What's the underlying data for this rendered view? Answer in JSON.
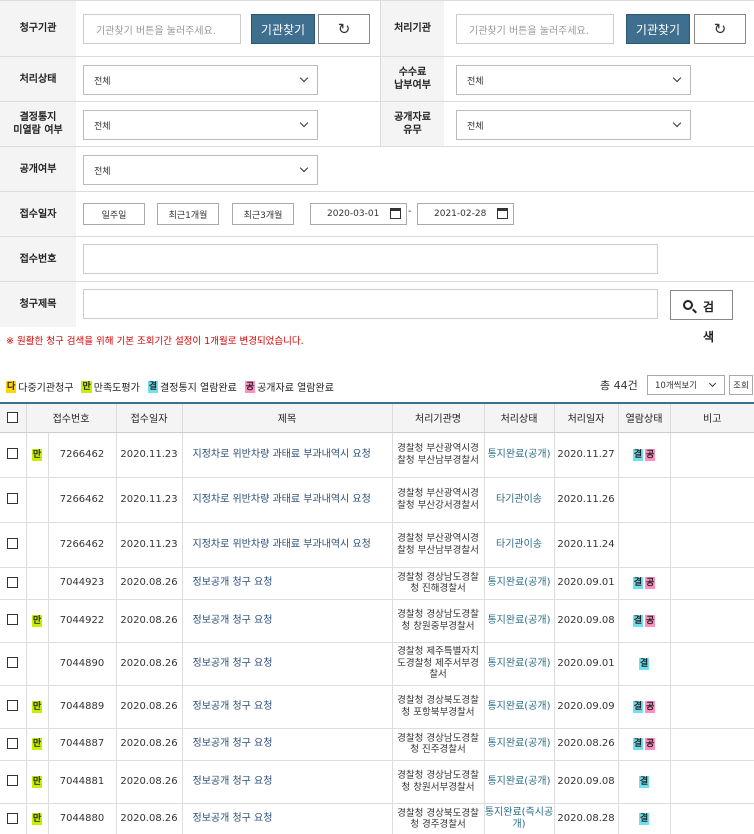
{
  "form": {
    "claim_org_label": "청구기관",
    "org_placeholder": "기관찾기 버튼을 눌러주세요.",
    "find_btn": "기관찾기",
    "proc_org_label": "처리기관",
    "proc_status_label": "처리상태",
    "fee_label_1": "수수료",
    "fee_label_2": "납부여부",
    "notice_label_1": "결정통지",
    "notice_label_2": "미열람 여부",
    "data_label_1": "공개자료",
    "data_label_2": "유무",
    "open_label": "공개여부",
    "all_option": "전체",
    "date_label": "접수일자",
    "period_1w": "일주일",
    "period_1m": "최근1개월",
    "period_3m": "최근3개월",
    "date_from": "2020-03-01",
    "date_to": "2021-02-28",
    "date_sep": "-",
    "recv_no_label": "접수번호",
    "title_label": "청구제목",
    "search_btn_1": "검",
    "search_btn_2": "색",
    "notice_msg": "※ 원활한 청구 검색을 위해 기본 조회기간 설정이 1개월로 변경되었습니다."
  },
  "legend": [
    {
      "badge": "다",
      "text": "다중기관청구",
      "color": "#ffd600"
    },
    {
      "badge": "만",
      "text": "만족도평가",
      "color": "#c6f000"
    },
    {
      "badge": "결",
      "text": "결정통지 열람완료",
      "color": "#6ee0f0"
    },
    {
      "badge": "공",
      "text": "공개자료 열람완료",
      "color": "#ff8fc0"
    }
  ],
  "total_text": "총 44건",
  "per_page": "10개씩보기",
  "view_btn": "조회",
  "columns": [
    "접수번호",
    "접수일자",
    "제목",
    "처리기관명",
    "처리상태",
    "처리일자",
    "열람상태",
    "비고"
  ],
  "rows": [
    {
      "man": "만",
      "no": "7266462",
      "date": "2020.11.23",
      "title": "지정차로 위반차량 과태료 부과내역시 요청",
      "org": "경찰청 부산광역시경찰청 부산남부경찰서",
      "status": "통지완료(공개)",
      "proc_date": "2020.11.27",
      "gyeol": "결",
      "gong": "공"
    },
    {
      "man": "",
      "no": "7266462",
      "date": "2020.11.23",
      "title": "지정차로 위반차량 과태료 부과내역시 요청",
      "org": "경찰청 부산광역시경찰청 부산강서경찰서",
      "status": "타기관이송",
      "proc_date": "2020.11.26",
      "gyeol": "",
      "gong": ""
    },
    {
      "man": "",
      "no": "7266462",
      "date": "2020.11.23",
      "title": "지정차로 위반차량 과태료 부과내역시 요청",
      "org": "경찰청 부산광역시경찰청 부산남부경찰서",
      "status": "타기관이송",
      "proc_date": "2020.11.24",
      "gyeol": "",
      "gong": ""
    },
    {
      "man": "",
      "no": "7044923",
      "date": "2020.08.26",
      "title": "정보공개 청구 요청",
      "org": "경찰청 경상남도경찰청 진해경찰서",
      "status": "통지완료(공개)",
      "proc_date": "2020.09.01",
      "gyeol": "결",
      "gong": "공"
    },
    {
      "man": "만",
      "no": "7044922",
      "date": "2020.08.26",
      "title": "정보공개 청구 요청",
      "org": "경찰청 경상남도경찰청 창원중부경찰서",
      "status": "통지완료(공개)",
      "proc_date": "2020.09.08",
      "gyeol": "결",
      "gong": "공"
    },
    {
      "man": "",
      "no": "7044890",
      "date": "2020.08.26",
      "title": "정보공개 청구 요청",
      "org": "경찰청 제주특별자치도경찰청 제주서부경찰서",
      "status": "통지완료(공개)",
      "proc_date": "2020.09.01",
      "gyeol": "결",
      "gong": ""
    },
    {
      "man": "만",
      "no": "7044889",
      "date": "2020.08.26",
      "title": "정보공개 청구 요청",
      "org": "경찰청 경상북도경찰청 포항북부경찰서",
      "status": "통지완료(공개)",
      "proc_date": "2020.09.09",
      "gyeol": "결",
      "gong": "공"
    },
    {
      "man": "만",
      "no": "7044887",
      "date": "2020.08.26",
      "title": "정보공개 청구 요청",
      "org": "경찰청 경상남도경찰청 진주경찰서",
      "status": "통지완료(공개)",
      "proc_date": "2020.08.26",
      "gyeol": "결",
      "gong": "공"
    },
    {
      "man": "만",
      "no": "7044881",
      "date": "2020.08.26",
      "title": "정보공개 청구 요청",
      "org": "경찰청 경상남도경찰청 창원서부경찰서",
      "status": "통지완료(공개)",
      "proc_date": "2020.09.08",
      "gyeol": "결",
      "gong": ""
    },
    {
      "man": "만",
      "no": "7044880",
      "date": "2020.08.26",
      "title": "정보공개 청구 요청",
      "org": "경찰청 경상북도경찰청 경주경찰서",
      "status": "통지완료(즉시공개)",
      "proc_date": "2020.08.28",
      "gyeol": "결",
      "gong": ""
    }
  ]
}
